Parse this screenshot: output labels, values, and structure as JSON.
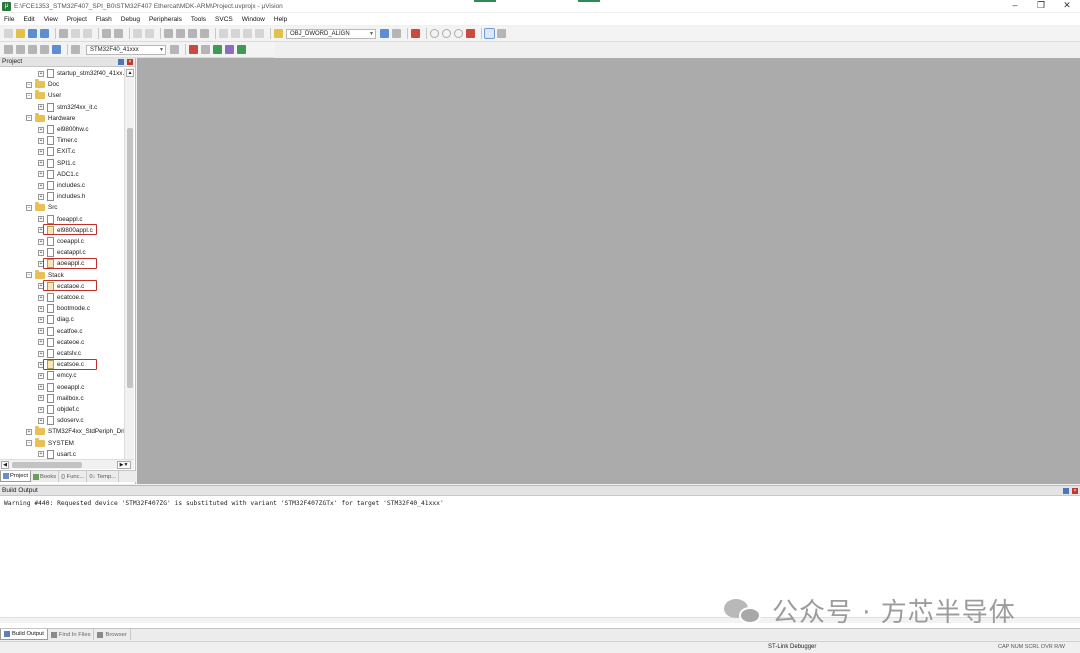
{
  "window": {
    "title": "E:\\FCE1353_STM32F407_SPI_B0\\STM32F407 Ethercat\\MDK-ARM\\Project.uvprojx - µVision",
    "minimize": "–",
    "maximize": "❐",
    "close": "✕"
  },
  "menu": [
    "File",
    "Edit",
    "View",
    "Project",
    "Flash",
    "Debug",
    "Peripherals",
    "Tools",
    "SVCS",
    "Window",
    "Help"
  ],
  "toolbar": {
    "find_combo": "OBJ_DWORD_ALIGN",
    "target_combo": "STM32F40_41xxx"
  },
  "project_panel": {
    "title": "Project",
    "tree": [
      {
        "label": "startup_stm32f40_41xx.s",
        "type": "file",
        "indent": 2
      },
      {
        "label": "Doc",
        "type": "folder",
        "indent": 1
      },
      {
        "label": "User",
        "type": "folder",
        "indent": 1
      },
      {
        "label": "stm32f4xx_it.c",
        "type": "file",
        "indent": 2
      },
      {
        "label": "Hardware",
        "type": "folder",
        "indent": 1
      },
      {
        "label": "el9800hw.c",
        "type": "file",
        "indent": 2
      },
      {
        "label": "Timer.c",
        "type": "file",
        "indent": 2
      },
      {
        "label": "EXIT.c",
        "type": "file",
        "indent": 2
      },
      {
        "label": "SPI1.c",
        "type": "file",
        "indent": 2
      },
      {
        "label": "ADC1.c",
        "type": "file",
        "indent": 2
      },
      {
        "label": "includes.c",
        "type": "file",
        "indent": 2
      },
      {
        "label": "includes.h",
        "type": "file",
        "indent": 2
      },
      {
        "label": "Src",
        "type": "folder",
        "indent": 1
      },
      {
        "label": "foeappl.c",
        "type": "file",
        "indent": 2
      },
      {
        "label": "el9800appl.c",
        "type": "file",
        "indent": 2,
        "highlight": true,
        "locked": true
      },
      {
        "label": "coeappl.c",
        "type": "file",
        "indent": 2
      },
      {
        "label": "ecatappl.c",
        "type": "file",
        "indent": 2
      },
      {
        "label": "aoeappl.c",
        "type": "file",
        "indent": 2,
        "highlight": true,
        "locked": true
      },
      {
        "label": "Stack",
        "type": "folder",
        "indent": 1
      },
      {
        "label": "ecataoe.c",
        "type": "file",
        "indent": 2,
        "highlight": true,
        "locked": true
      },
      {
        "label": "ecatcoe.c",
        "type": "file",
        "indent": 2
      },
      {
        "label": "bootmode.c",
        "type": "file",
        "indent": 2
      },
      {
        "label": "diag.c",
        "type": "file",
        "indent": 2
      },
      {
        "label": "ecatfoe.c",
        "type": "file",
        "indent": 2
      },
      {
        "label": "ecateoe.c",
        "type": "file",
        "indent": 2
      },
      {
        "label": "ecatslv.c",
        "type": "file",
        "indent": 2
      },
      {
        "label": "ecatsoe.c",
        "type": "file",
        "indent": 2,
        "highlight": true,
        "locked": true
      },
      {
        "label": "emcy.c",
        "type": "file",
        "indent": 2
      },
      {
        "label": "eoeappl.c",
        "type": "file",
        "indent": 2
      },
      {
        "label": "mailbox.c",
        "type": "file",
        "indent": 2
      },
      {
        "label": "objdef.c",
        "type": "file",
        "indent": 2
      },
      {
        "label": "sdoserv.c",
        "type": "file",
        "indent": 2
      },
      {
        "label": "STM32F4xx_StdPeriph_Dri",
        "type": "folder",
        "indent": 1,
        "collapsed": true
      },
      {
        "label": "SYSTEM",
        "type": "folder",
        "indent": 1
      },
      {
        "label": "usart.c",
        "type": "file",
        "indent": 2
      }
    ],
    "tabs": [
      "Project",
      "Books",
      "{} Func...",
      "0↓ Temp..."
    ]
  },
  "build_output": {
    "title": "Build Output",
    "text": "Warning #440: Requested device 'STM32F407ZG' is substituted with variant 'STM32F407ZGTx' for target 'STM32F40_41xxx'"
  },
  "bottom_tabs": [
    "Build Output",
    "Find In Files",
    "Browser"
  ],
  "status": {
    "debugger": "ST-Link Debugger",
    "keys": "CAP  NUM  SCRL  OVR  R/W"
  },
  "watermark": "公众号 · 方芯半导体",
  "colors": {
    "editor_bg": "#ababab",
    "highlight": "#c0312b",
    "folder": "#e8c156"
  }
}
